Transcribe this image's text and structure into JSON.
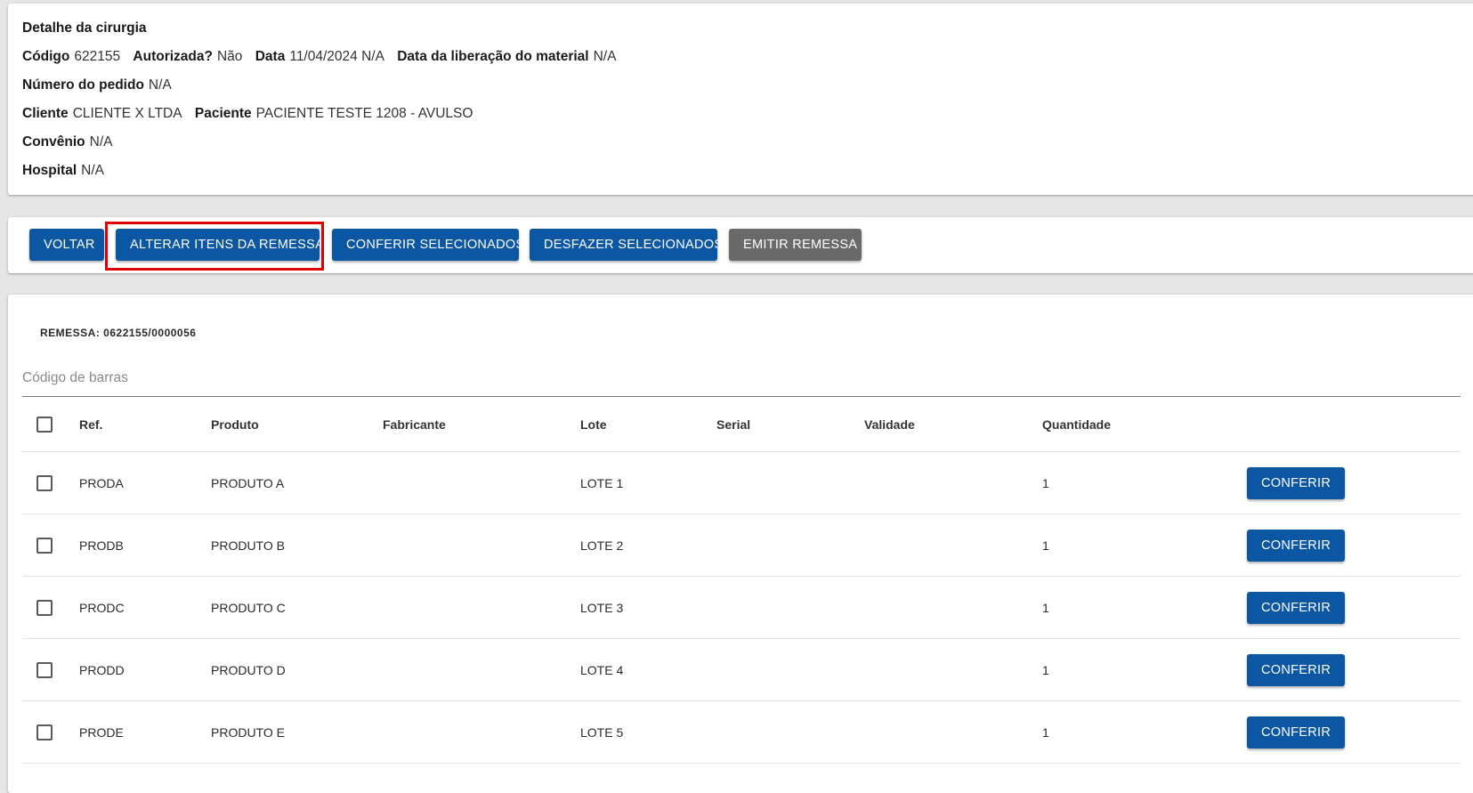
{
  "detail": {
    "title": "Detalhe da cirurgia",
    "codigo_label": "Código",
    "codigo_value": "622155",
    "autorizada_label": "Autorizada?",
    "autorizada_value": "Não",
    "data_label": "Data",
    "data_value": "11/04/2024 N/A",
    "liberacao_label": "Data da liberação do material",
    "liberacao_value": "N/A",
    "pedido_label": "Número do pedido",
    "pedido_value": "N/A",
    "cliente_label": "Cliente",
    "cliente_value": "CLIENTE X LTDA",
    "paciente_label": "Paciente",
    "paciente_value": "PACIENTE TESTE 1208 - AVULSO",
    "convenio_label": "Convênio",
    "convenio_value": "N/A",
    "hospital_label": "Hospital",
    "hospital_value": "N/A"
  },
  "actions": {
    "voltar": "VOLTAR",
    "alterar": "ALTERAR ITENS DA REMESSA",
    "conferir_sel": "CONFERIR SELECIONADOS",
    "desfazer_sel": "DESFAZER SELECIONADOS",
    "emitir": "EMITIR REMESSA"
  },
  "remessa": {
    "label": "REMESSA: 0622155/0000056",
    "barcode_placeholder": "Código de barras"
  },
  "table": {
    "headers": {
      "ref": "Ref.",
      "produto": "Produto",
      "fabricante": "Fabricante",
      "lote": "Lote",
      "serial": "Serial",
      "validade": "Validade",
      "quantidade": "Quantidade"
    },
    "row_button": "CONFERIR",
    "rows": [
      {
        "ref": "PRODA",
        "produto": "PRODUTO A",
        "fabricante": "",
        "lote": "LOTE 1",
        "serial": "",
        "validade": "",
        "quantidade": "1"
      },
      {
        "ref": "PRODB",
        "produto": "PRODUTO B",
        "fabricante": "",
        "lote": "LOTE 2",
        "serial": "",
        "validade": "",
        "quantidade": "1"
      },
      {
        "ref": "PRODC",
        "produto": "PRODUTO C",
        "fabricante": "",
        "lote": "LOTE 3",
        "serial": "",
        "validade": "",
        "quantidade": "1"
      },
      {
        "ref": "PRODD",
        "produto": "PRODUTO D",
        "fabricante": "",
        "lote": "LOTE 4",
        "serial": "",
        "validade": "",
        "quantidade": "1"
      },
      {
        "ref": "PRODE",
        "produto": "PRODUTO E",
        "fabricante": "",
        "lote": "LOTE 5",
        "serial": "",
        "validade": "",
        "quantidade": "1"
      }
    ]
  },
  "colors": {
    "primary_button": "#0b57a4",
    "disabled_button": "#6a6a6a",
    "highlight": "#e00000"
  }
}
